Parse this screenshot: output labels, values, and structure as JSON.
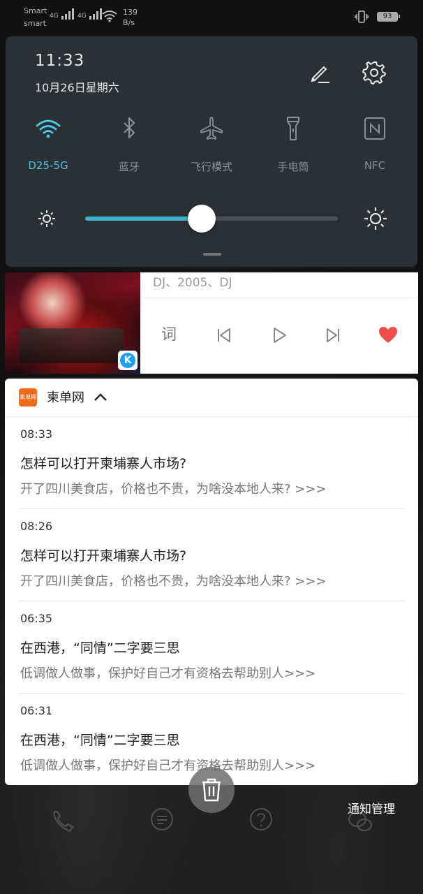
{
  "status_bar": {
    "carrier1": "Smart",
    "carrier2": "smart",
    "net1": "4G",
    "net2": "4G",
    "speed_value": "139",
    "speed_unit": "B/s",
    "battery": "93"
  },
  "quick_settings": {
    "time": "11:33",
    "date": "10月26日星期六",
    "tiles": [
      {
        "label": "D25-5G",
        "icon": "wifi-icon",
        "active": true
      },
      {
        "label": "蓝牙",
        "icon": "bluetooth-icon",
        "active": false
      },
      {
        "label": "飞行模式",
        "icon": "airplane-icon",
        "active": false
      },
      {
        "label": "手电筒",
        "icon": "flashlight-icon",
        "active": false
      },
      {
        "label": "NFC",
        "icon": "nfc-icon",
        "active": false
      }
    ],
    "brightness": 0.46,
    "accent_color": "#4cc3e0"
  },
  "music": {
    "subtitle": "DJ、2005、DJ",
    "lyrics_label": "词",
    "badge": "K",
    "heart_color": "#f04d4d"
  },
  "news": {
    "app_name": "柬单网",
    "app_icon_text": "柬单网",
    "items": [
      {
        "time": "08:33",
        "title": "怎样可以打开柬埔寨人市场?",
        "summary": "开了四川美食店，价格也不贵，为啥没本地人来? >>>"
      },
      {
        "time": "08:26",
        "title": "怎样可以打开柬埔寨人市场?",
        "summary": "开了四川美食店，价格也不贵，为啥没本地人来? >>>"
      },
      {
        "time": "06:35",
        "title": "在西港，“同情”二字要三思",
        "summary": "低调做人做事，保护好自己才有资格去帮助别人>>>"
      },
      {
        "time": "06:31",
        "title": "在西港，“同情”二字要三思",
        "summary": "低调做人做事，保护好自己才有资格去帮助别人>>>"
      }
    ]
  },
  "bottom": {
    "manage_label": "通知管理"
  }
}
